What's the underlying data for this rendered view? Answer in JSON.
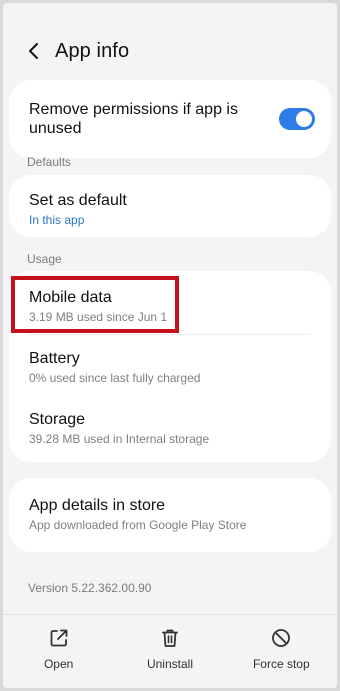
{
  "header": {
    "title": "App info"
  },
  "permissions": {
    "label": "Remove permissions if app is unused",
    "toggle_on": true
  },
  "sections": {
    "defaults_label": "Defaults",
    "usage_label": "Usage"
  },
  "defaults": {
    "set_default_title": "Set as default",
    "set_default_sub": "In this app"
  },
  "usage": {
    "mobile_data_title": "Mobile data",
    "mobile_data_sub": "3.19 MB used since Jun 1",
    "battery_title": "Battery",
    "battery_sub": "0% used since last fully charged",
    "storage_title": "Storage",
    "storage_sub": "39.28 MB used in Internal storage"
  },
  "store": {
    "title": "App details in store",
    "sub": "App downloaded from Google Play Store"
  },
  "version": "Version 5.22.362.00.90",
  "actions": {
    "open": "Open",
    "uninstall": "Uninstall",
    "force_stop": "Force stop"
  },
  "colors": {
    "accent": "#2d7de6",
    "link": "#2c74c9",
    "highlight": "#c5121a"
  }
}
